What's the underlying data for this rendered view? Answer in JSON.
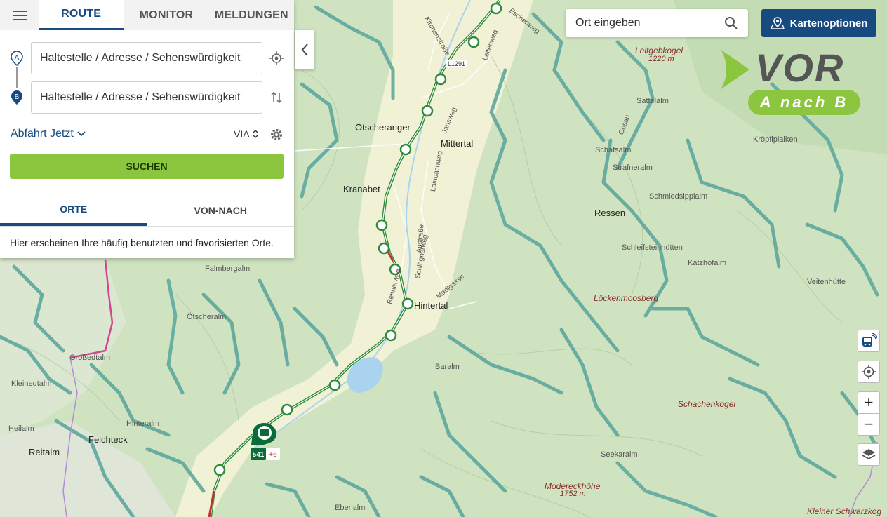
{
  "tabs": [
    {
      "label": "ROUTE",
      "active": true
    },
    {
      "label": "MONITOR",
      "active": false
    },
    {
      "label": "MELDUNGEN",
      "active": false
    }
  ],
  "route": {
    "from_label": "A",
    "to_label": "B",
    "from_value": "Haltestelle / Adresse / Sehenswürdigkeit",
    "to_value": "Haltestelle / Adresse / Sehenswürdigkeit",
    "departure": "Abfahrt Jetzt",
    "via": "VIA",
    "search_button": "SUCHEN"
  },
  "subtabs": [
    {
      "label": "ORTE",
      "active": true
    },
    {
      "label": "VON-NACH",
      "active": false
    }
  ],
  "hint": "Hier erscheinen Ihre häufig benutzten und favorisierten Orte.",
  "map_search": {
    "value": "Ort eingeben"
  },
  "kartenoptionen": "Kartenoptionen",
  "logo": {
    "text": "VOR",
    "sub": "A nach B"
  },
  "controls": {
    "zoom_in": "+",
    "zoom_out": "−"
  },
  "station_marker": {
    "line": "541",
    "extra": "+6"
  },
  "colors": {
    "accent": "#174b7f",
    "search": "#8cc63f",
    "route": "#2e8b3a",
    "marker": "#0b6b3a"
  },
  "map_labels": {
    "major": [
      "Ötscheranger",
      "Mittertal",
      "Kranabet",
      "Feichteck",
      "Reitalm",
      "Ressen"
    ],
    "peaks": [
      "Leitgebkogel",
      "Löckenmoosberg",
      "Schachenkogel",
      "Modereckhöhe",
      "Kleiner Schwarzkog"
    ],
    "elevations": [
      "1220 m",
      "1752 m"
    ],
    "minor": [
      "Sattelalm",
      "Kröpflplaiken",
      "Strafneralm",
      "Schmiedsipplalm",
      "Schleifsteinhütten",
      "Katzhofalm",
      "Veitenhütte",
      "Falmbergalm",
      "Ötscheralm",
      "Großedtalm",
      "Kleinedtalm",
      "Heilalm",
      "Baralm",
      "Seekaralm",
      "Ebenalm",
      "Schafsalm",
      "Hinteralm",
      "Eschenweg",
      "Leitenweg",
      "Jansweg",
      "Lainbachweg",
      "Schlögnerweg",
      "Rennerweg",
      "Madlgasse",
      "Kirchenstraße",
      "Austraße",
      "Gosau",
      "L1291"
    ],
    "town": "Hintertal"
  }
}
